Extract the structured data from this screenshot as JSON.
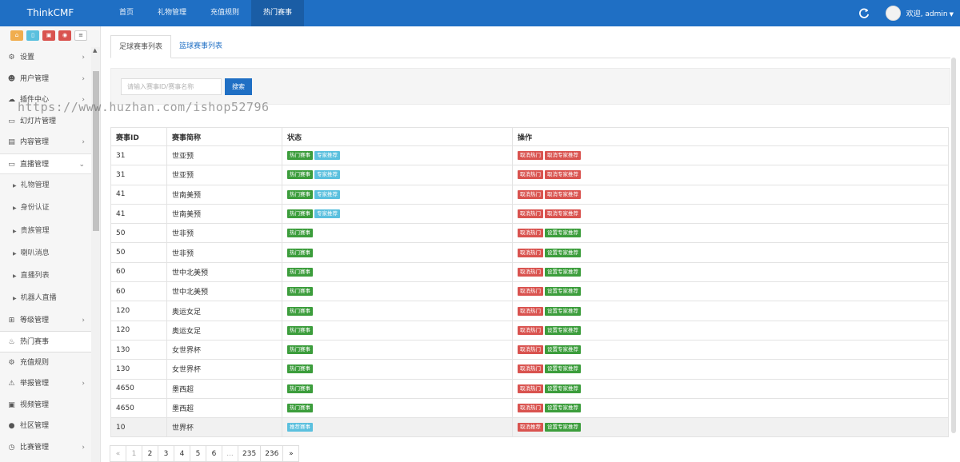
{
  "brand": "ThinkCMF",
  "topnav": [
    {
      "label": "首页",
      "active": false
    },
    {
      "label": "礼物管理",
      "active": false
    },
    {
      "label": "充值规则",
      "active": false
    },
    {
      "label": "热门赛事",
      "active": true
    }
  ],
  "user": {
    "welcome": "欢迎, admin"
  },
  "sidebar": {
    "menu": [
      {
        "label": "设置",
        "icon": "gears-icon",
        "arrow": true
      },
      {
        "label": "用户管理",
        "icon": "users-icon",
        "arrow": true
      },
      {
        "label": "插件中心",
        "icon": "cloud-icon",
        "arrow": true
      },
      {
        "label": "幻灯片管理",
        "icon": "desktop-icon",
        "arrow": false
      },
      {
        "label": "内容管理",
        "icon": "archive-icon",
        "arrow": true
      },
      {
        "label": "直播管理",
        "icon": "desktop-icon",
        "arrow": true,
        "expanded": true
      }
    ],
    "submenu": [
      "礼物管理",
      "身份认证",
      "贵族管理",
      "喇叭消息",
      "直播列表",
      "机器人直播"
    ],
    "menu2": [
      {
        "label": "等级管理",
        "icon": "sitemap-icon",
        "arrow": true
      },
      {
        "label": "热门赛事",
        "icon": "fire-icon",
        "arrow": false,
        "current": true
      },
      {
        "label": "充值规则",
        "icon": "gears-icon",
        "arrow": false
      },
      {
        "label": "举报管理",
        "icon": "warning-icon",
        "arrow": true
      },
      {
        "label": "视频管理",
        "icon": "video-icon",
        "arrow": false
      },
      {
        "label": "社区管理",
        "icon": "comment-icon",
        "arrow": false
      },
      {
        "label": "比赛管理",
        "icon": "clock-icon",
        "arrow": true
      }
    ]
  },
  "tabs": [
    {
      "label": "足球赛事列表",
      "active": true
    },
    {
      "label": "篮球赛事列表",
      "active": false
    }
  ],
  "search": {
    "placeholder": "请输入赛事ID/赛事名称",
    "button": "搜索"
  },
  "table": {
    "headers": [
      "赛事ID",
      "赛事简称",
      "状态",
      "操作"
    ],
    "rows": [
      {
        "id": "31",
        "name": "世亚预",
        "status": [
          "热门赛事",
          "专家推荐"
        ],
        "actions": [
          "取消热门",
          "取消专家推荐"
        ]
      },
      {
        "id": "31",
        "name": "世亚预",
        "status": [
          "热门赛事",
          "专家推荐"
        ],
        "actions": [
          "取消热门",
          "取消专家推荐"
        ]
      },
      {
        "id": "41",
        "name": "世南美预",
        "status": [
          "热门赛事",
          "专家推荐"
        ],
        "actions": [
          "取消热门",
          "取消专家推荐"
        ]
      },
      {
        "id": "41",
        "name": "世南美预",
        "status": [
          "热门赛事",
          "专家推荐"
        ],
        "actions": [
          "取消热门",
          "取消专家推荐"
        ]
      },
      {
        "id": "50",
        "name": "世非预",
        "status": [
          "热门赛事"
        ],
        "actions": [
          "取消热门",
          "设置专家推荐"
        ]
      },
      {
        "id": "50",
        "name": "世非预",
        "status": [
          "热门赛事"
        ],
        "actions": [
          "取消热门",
          "设置专家推荐"
        ]
      },
      {
        "id": "60",
        "name": "世中北美预",
        "status": [
          "热门赛事"
        ],
        "actions": [
          "取消热门",
          "设置专家推荐"
        ]
      },
      {
        "id": "60",
        "name": "世中北美预",
        "status": [
          "热门赛事"
        ],
        "actions": [
          "取消热门",
          "设置专家推荐"
        ]
      },
      {
        "id": "120",
        "name": "奥运女足",
        "status": [
          "热门赛事"
        ],
        "actions": [
          "取消热门",
          "设置专家推荐"
        ]
      },
      {
        "id": "120",
        "name": "奥运女足",
        "status": [
          "热门赛事"
        ],
        "actions": [
          "取消热门",
          "设置专家推荐"
        ]
      },
      {
        "id": "130",
        "name": "女世界杯",
        "status": [
          "热门赛事"
        ],
        "actions": [
          "取消热门",
          "设置专家推荐"
        ]
      },
      {
        "id": "130",
        "name": "女世界杯",
        "status": [
          "热门赛事"
        ],
        "actions": [
          "取消热门",
          "设置专家推荐"
        ]
      },
      {
        "id": "4650",
        "name": "墨西超",
        "status": [
          "热门赛事"
        ],
        "actions": [
          "取消热门",
          "设置专家推荐"
        ]
      },
      {
        "id": "4650",
        "name": "墨西超",
        "status": [
          "热门赛事"
        ],
        "actions": [
          "取消热门",
          "设置专家推荐"
        ]
      },
      {
        "id": "10",
        "name": "世界杯",
        "status": [
          "推荐赛事"
        ],
        "actions": [
          "取消推荐",
          "设置专家推荐"
        ],
        "highlight": true
      }
    ]
  },
  "pagination": [
    "«",
    "1",
    "2",
    "3",
    "4",
    "5",
    "6",
    "...",
    "235",
    "236",
    "»"
  ],
  "watermark": "https://www.huzhan.com/ishop52796",
  "colors": {
    "primary": "#1f6fc4",
    "success": "#3c9d3c",
    "info": "#5bc0de",
    "danger": "#d9534f"
  }
}
